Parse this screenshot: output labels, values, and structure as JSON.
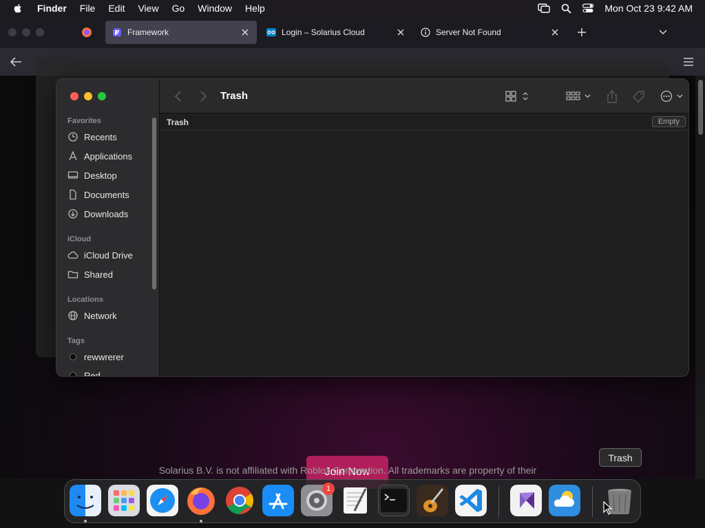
{
  "menubar": {
    "items": [
      "Finder",
      "File",
      "Edit",
      "View",
      "Go",
      "Window",
      "Help"
    ],
    "clock": "Mon Oct 23  9:42 AM"
  },
  "browser": {
    "tabs": [
      {
        "title": "Framework",
        "active": true
      },
      {
        "title": "Login – Solarius Cloud",
        "active": false
      },
      {
        "title": "Server Not Found",
        "active": false
      }
    ],
    "join_button": "Join Now",
    "disclaimer": "Solarius B.V. is not affiliated with Roblox Corporation. All trademarks are property of their"
  },
  "finder": {
    "title": "Trash",
    "path_label": "Trash",
    "empty_button": "Empty",
    "sidebar": {
      "favorites_label": "Favorites",
      "favorites": [
        "Recents",
        "Applications",
        "Desktop",
        "Documents",
        "Downloads"
      ],
      "icloud_label": "iCloud",
      "icloud": [
        "iCloud Drive",
        "Shared"
      ],
      "locations_label": "Locations",
      "locations": [
        "Network"
      ],
      "tags_label": "Tags",
      "tags": [
        "rewwrerer",
        "Red"
      ]
    }
  },
  "dock": {
    "apps": [
      "Finder",
      "Launchpad",
      "Safari",
      "Firefox",
      "Chrome",
      "App Store",
      "System Settings",
      "TextEdit",
      "Terminal",
      "GarageBand",
      "Visual Studio Code",
      "Visual Studio",
      "Weather",
      "Trash"
    ],
    "settings_badge": "1",
    "tooltip": "Trash"
  },
  "colors": {
    "accent": "#b01f5b",
    "traffic_red": "#ff5f57",
    "traffic_yellow": "#febc2e",
    "traffic_green": "#28c840"
  }
}
